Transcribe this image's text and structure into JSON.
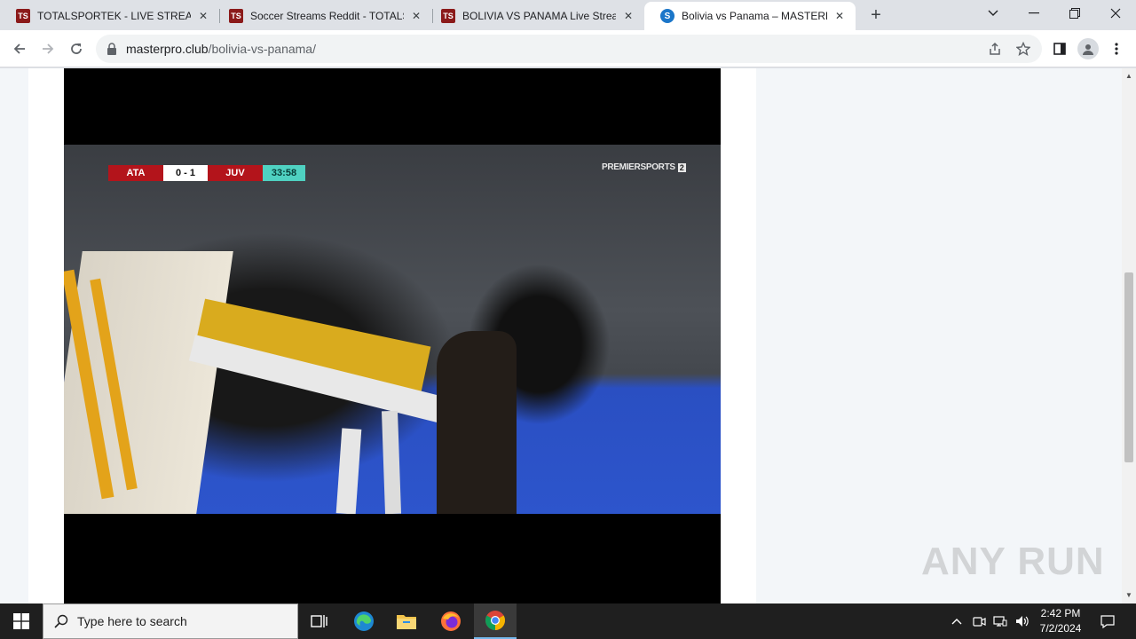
{
  "browser": {
    "tabs": [
      {
        "title": "TOTALSPORTEK - LIVE STREAMS",
        "favicon": "TS"
      },
      {
        "title": "Soccer Streams Reddit - TOTALSP",
        "favicon": "TS"
      },
      {
        "title": "BOLIVIA VS PANAMA Live Stream",
        "favicon": "TS"
      },
      {
        "title": "Bolivia vs Panama – MASTERPRO",
        "favicon": "S"
      }
    ],
    "active_tab_index": 3,
    "url_host": "masterpro.club",
    "url_path": "/bolivia-vs-panama/"
  },
  "video": {
    "scorebug": {
      "home": "ATA",
      "score": "0 - 1",
      "away": "JUV",
      "time": "33:58"
    },
    "broadcaster": "PREMIERSPORTS",
    "channel": "2"
  },
  "watermark": "ANY RUN",
  "taskbar": {
    "search_placeholder": "Type here to search",
    "time": "2:42 PM",
    "date": "7/2/2024"
  },
  "colors": {
    "scorebug_red": "#b3141b",
    "scorebug_teal": "#4fd1c1",
    "taskbar": "#1f1f1f"
  }
}
